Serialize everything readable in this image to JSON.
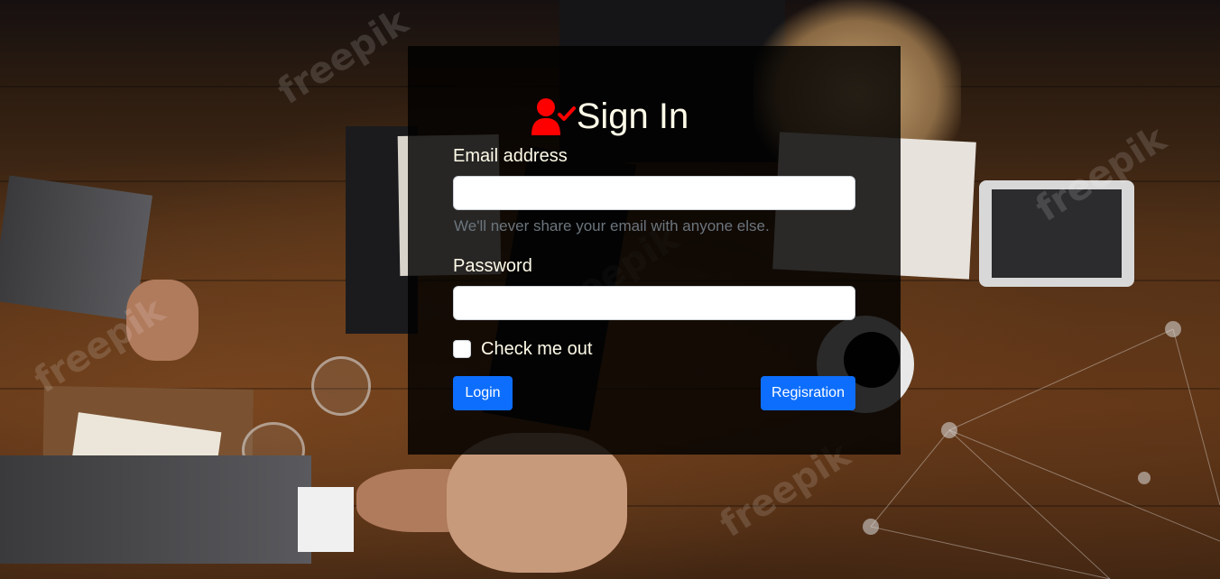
{
  "form": {
    "title": "Sign In",
    "title_icon": "user-check-icon",
    "email_label": "Email address",
    "email_value": "",
    "email_help": "We'll never share your email with anyone else.",
    "password_label": "Password",
    "password_value": "",
    "checkbox_label": "Check me out",
    "checkbox_checked": false,
    "login_button": "Login",
    "registration_button": "Regisration"
  },
  "background": {
    "watermark_text": "freepik"
  },
  "colors": {
    "accent": "#0d6efd",
    "icon": "#ff0000",
    "title_text": "#fffbe8",
    "help_text": "#6c757d",
    "card_background": "rgba(0,0,0,0.82)"
  }
}
